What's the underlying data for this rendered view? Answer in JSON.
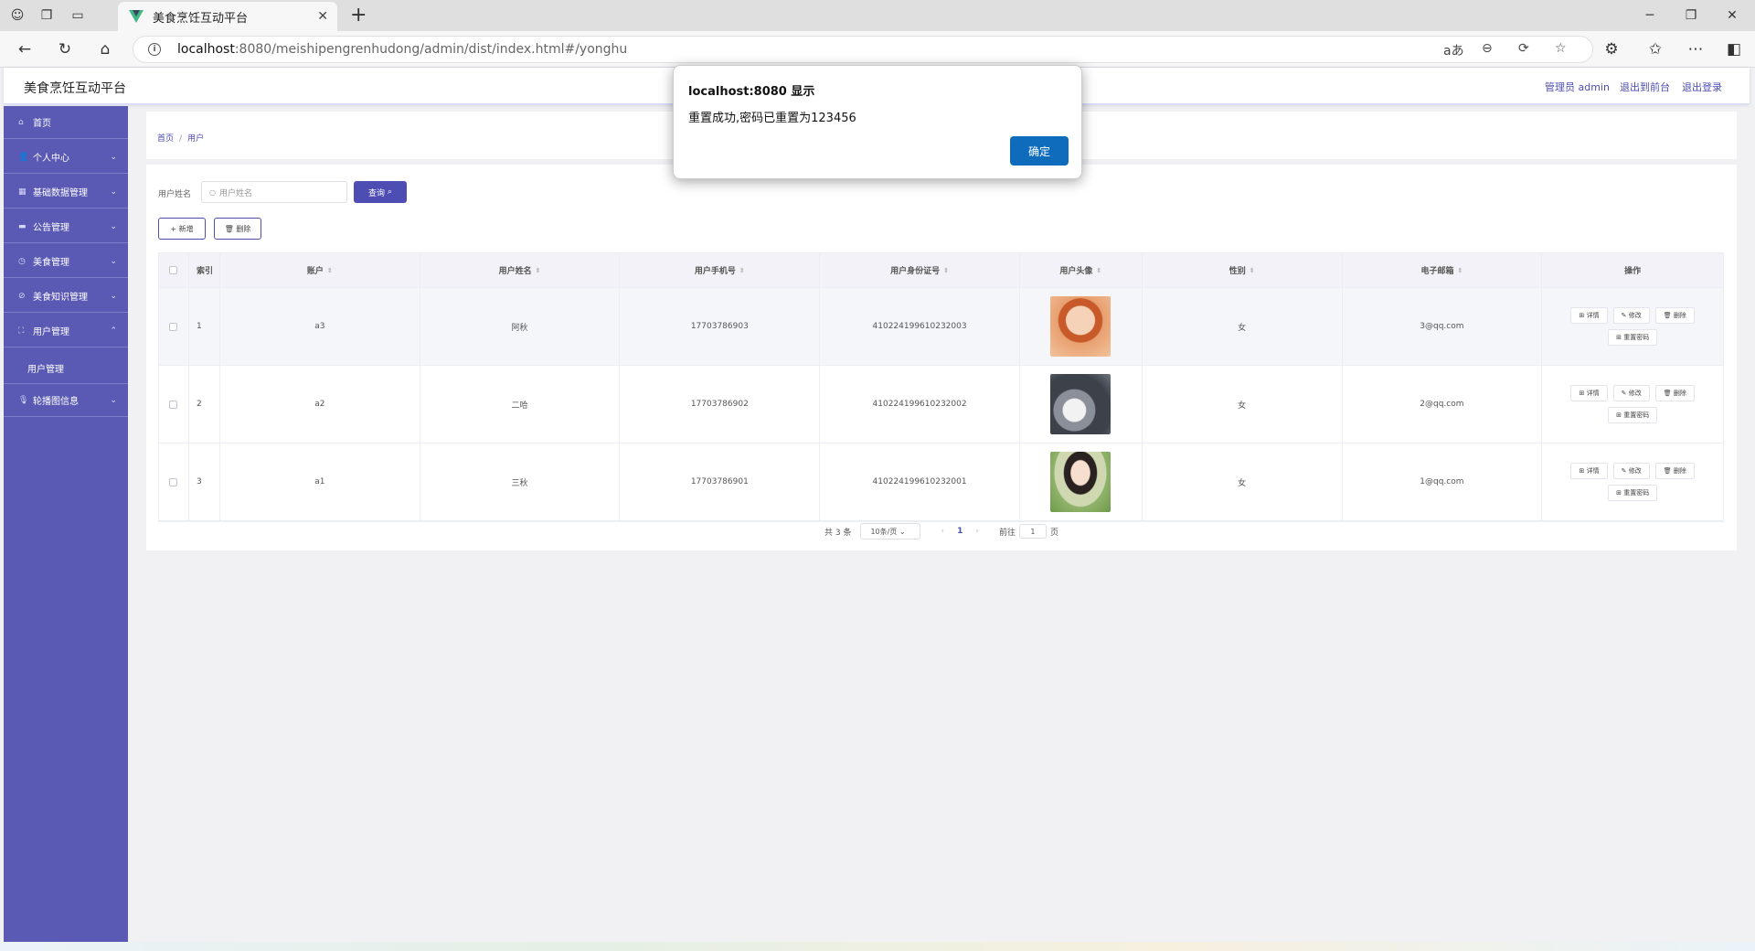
{
  "browser": {
    "tab_title": "美食烹饪互动平台",
    "url_host": "localhost",
    "url_rest": ":8080/meishipengrenhudong/admin/dist/index.html#/yonghu"
  },
  "app": {
    "title": "美食烹饪互动平台",
    "header_links": [
      "管理员 admin",
      "退出到前台",
      "退出登录"
    ]
  },
  "sidebar": {
    "items": [
      {
        "label": "首页",
        "icon": "home-icon"
      },
      {
        "label": "个人中心",
        "icon": "user-icon"
      },
      {
        "label": "基础数据管理",
        "icon": "grid-icon"
      },
      {
        "label": "公告管理",
        "icon": "notice-icon"
      },
      {
        "label": "美食管理",
        "icon": "food-icon"
      },
      {
        "label": "美食知识管理",
        "icon": "knowledge-icon"
      },
      {
        "label": "用户管理",
        "icon": "fullscreen-icon"
      },
      {
        "label": "轮播图信息",
        "icon": "microphone-icon"
      }
    ],
    "submenu": "用户管理"
  },
  "breadcrumb": [
    "首页",
    "用户"
  ],
  "search": {
    "label": "用户姓名",
    "placeholder": "用户姓名",
    "button": "查询"
  },
  "actions": {
    "add": "新增",
    "delete": "删除"
  },
  "table": {
    "headers": [
      "索引",
      "账户",
      "用户姓名",
      "用户手机号",
      "用户身份证号",
      "用户头像",
      "性别",
      "电子邮箱",
      "操作"
    ],
    "rows": [
      {
        "index": "1",
        "account": "a3",
        "name": "阿秋",
        "phone": "17703786903",
        "idcard": "410224199610232003",
        "sex": "女",
        "email": "3@qq.com"
      },
      {
        "index": "2",
        "account": "a2",
        "name": "二哈",
        "phone": "17703786902",
        "idcard": "410224199610232002",
        "sex": "女",
        "email": "2@qq.com"
      },
      {
        "index": "3",
        "account": "a1",
        "name": "三秋",
        "phone": "17703786901",
        "idcard": "410224199610232001",
        "sex": "女",
        "email": "1@qq.com"
      }
    ],
    "op_labels": {
      "detail": "详情",
      "edit": "修改",
      "delete": "删除",
      "reset": "重置密码"
    }
  },
  "pagination": {
    "total": "共 3 条",
    "page_size": "10条/页",
    "current": "1",
    "goto_label": "前往",
    "goto_value": "1",
    "page_unit": "页"
  },
  "dialog": {
    "title": "localhost:8080 显示",
    "message": "重置成功,密码已重置为123456",
    "ok": "确定"
  },
  "colors": {
    "accent": "#5a5ab5",
    "button": "#4d4db3",
    "dialog_ok": "#0f6cbd"
  }
}
